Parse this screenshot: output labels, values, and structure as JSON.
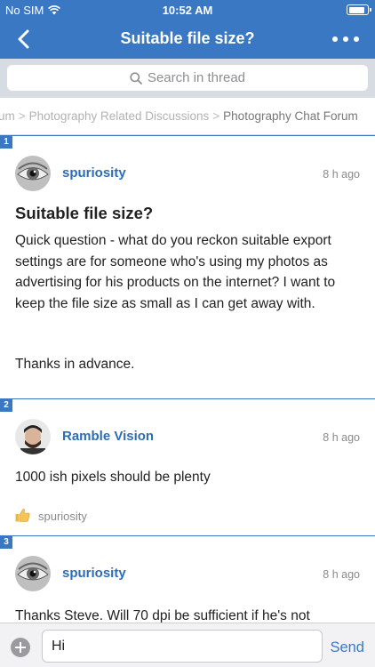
{
  "status_bar": {
    "carrier": "No SIM",
    "time": "10:52 AM",
    "battery_level": 0.92
  },
  "nav": {
    "title": "Suitable file size?",
    "back_icon": "chevron-left-icon",
    "more_icon": "more-dots-icon"
  },
  "search": {
    "placeholder": "Search in thread"
  },
  "breadcrumb": {
    "items": [
      "um",
      "Photography Related Discussions",
      "Photography Chat Forum"
    ],
    "separator": ">"
  },
  "posts": [
    {
      "number": "1",
      "author": "spuriosity",
      "time": "8 h ago",
      "title": "Suitable file size?",
      "body": "Quick question - what do you reckon suitable export settings are for someone who's using my photos as advertising for his products on the internet?  I want to keep the file size as small as I can get away with.",
      "body2": "Thanks in advance."
    },
    {
      "number": "2",
      "author": "Ramble Vision",
      "time": "8 h ago",
      "body": "1000 ish pixels  should be plenty",
      "like_user": "spuriosity"
    },
    {
      "number": "3",
      "author": "spuriosity",
      "time": "8 h ago",
      "body": "Thanks Steve. Will 70 dpi be sufficient if he's not"
    }
  ],
  "composer": {
    "value": "Hi",
    "send_label": "Send"
  },
  "colors": {
    "accent": "#3a78c4",
    "author": "#2e6db4"
  }
}
